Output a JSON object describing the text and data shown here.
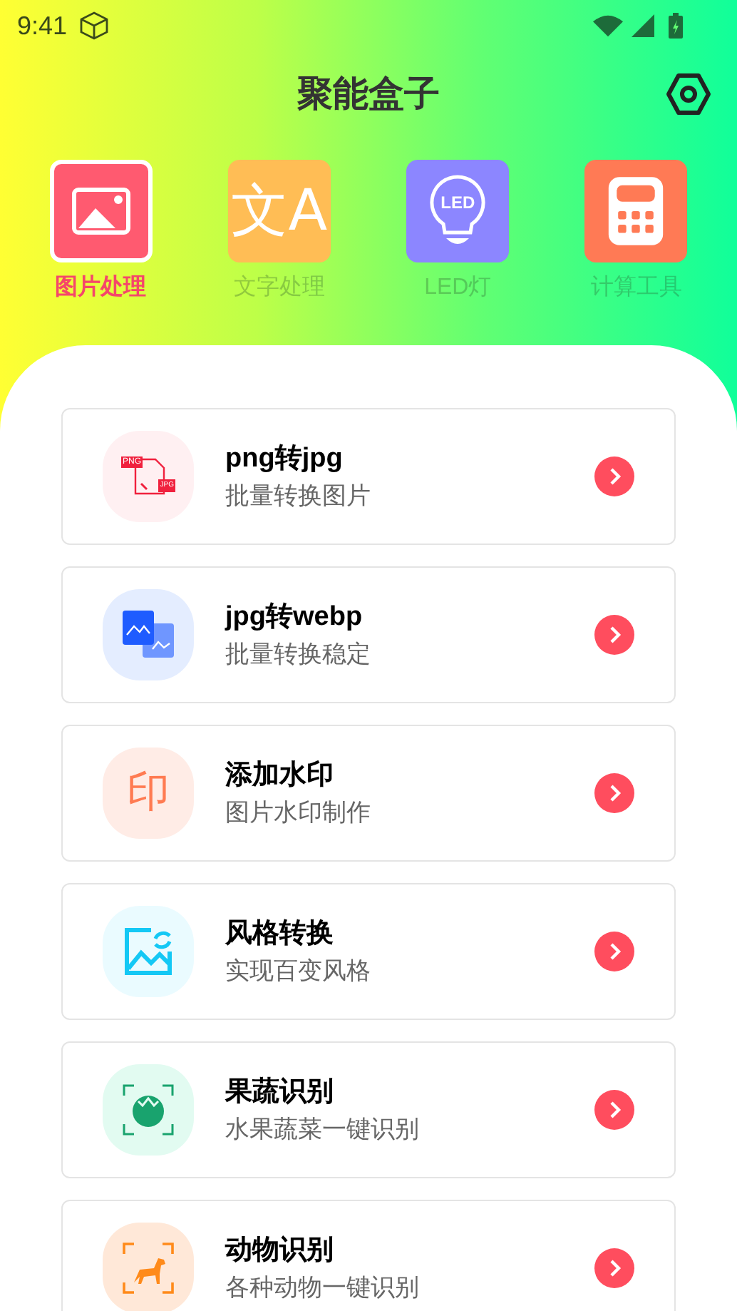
{
  "status_bar": {
    "time": "9:41"
  },
  "header": {
    "title": "聚能盒子"
  },
  "tabs": [
    {
      "label": "图片处理",
      "selected": true,
      "kind": "picture",
      "color": "#ff5a70"
    },
    {
      "label": "文字处理",
      "selected": false,
      "kind": "translate",
      "color": "#ffbd55",
      "icon_text": "文A"
    },
    {
      "label": "LED灯",
      "selected": false,
      "kind": "bulb",
      "color": "#8c86ff",
      "icon_text": "LED"
    },
    {
      "label": "计算工具",
      "selected": false,
      "kind": "calculator",
      "color": "#ff7a55"
    }
  ],
  "tools": [
    {
      "title": "png转jpg",
      "subtitle": "批量转换图片",
      "kind": "convert",
      "color": "#fff0f2",
      "icon_texts": [
        "PNG",
        "JPG"
      ]
    },
    {
      "title": "jpg转webp",
      "subtitle": "批量转换稳定",
      "kind": "images",
      "color": "#e4edff"
    },
    {
      "title": "添加水印",
      "subtitle": "图片水印制作",
      "kind": "seal",
      "color": "#ffece6",
      "icon_text": "印"
    },
    {
      "title": "风格转换",
      "subtitle": "实现百变风格",
      "kind": "restyle",
      "color": "#eafbff"
    },
    {
      "title": "果蔬识别",
      "subtitle": "水果蔬菜一键识别",
      "kind": "fruit",
      "color": "#e2fbf1"
    },
    {
      "title": "动物识别",
      "subtitle": "各种动物一键识别",
      "kind": "animal",
      "color": "#ffe8d8"
    }
  ]
}
